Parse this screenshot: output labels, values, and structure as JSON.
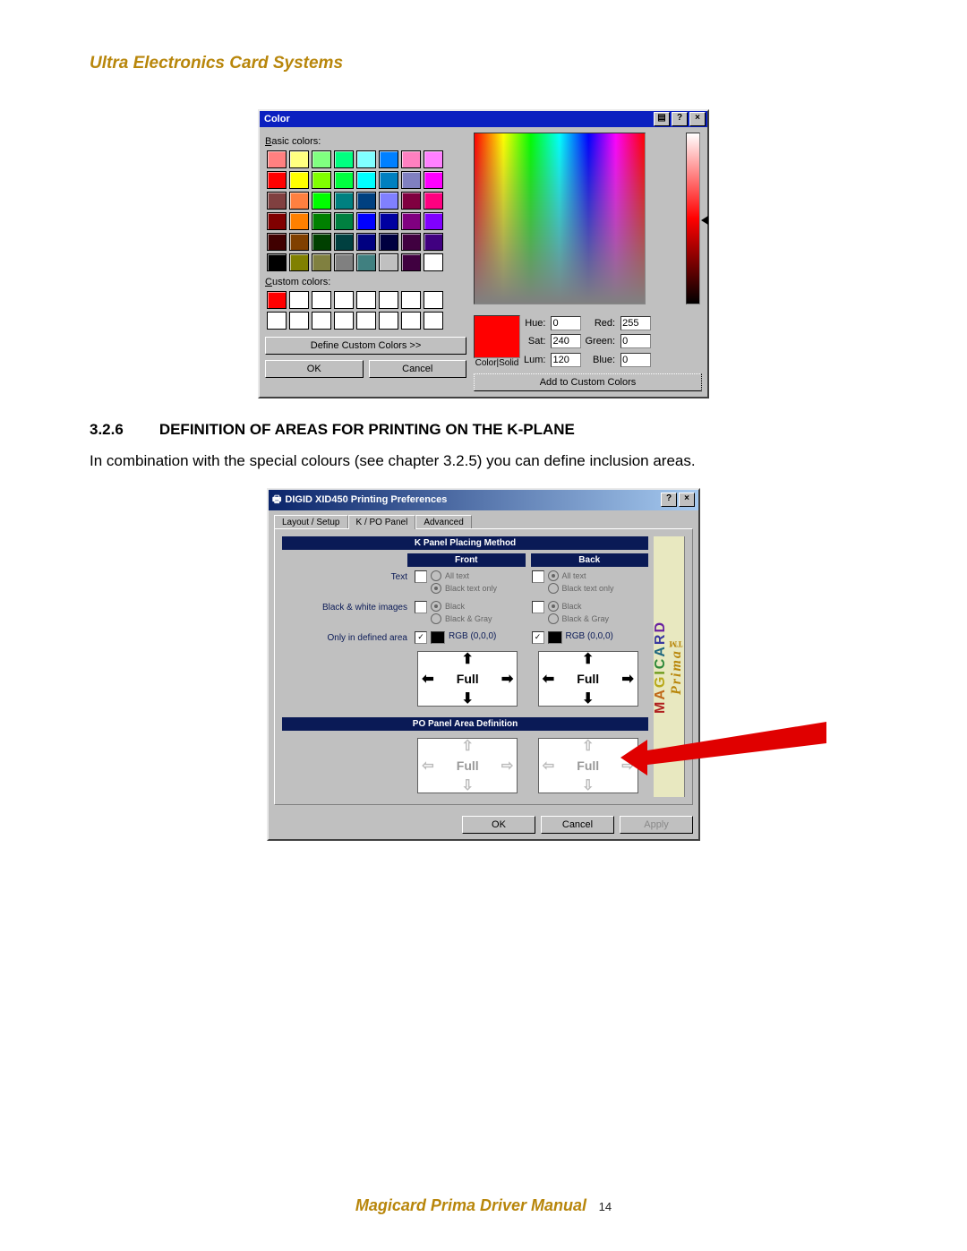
{
  "page": {
    "header_brand": "Ultra Electronics Card Systems",
    "footer_manual": "Magicard Prima Driver Manual",
    "footer_page": "14"
  },
  "color_dialog": {
    "title": "Color",
    "basic_label_pre": "B",
    "basic_label_post": "asic colors:",
    "custom_label_pre": "C",
    "custom_label_post": "ustom colors:",
    "define_btn": "Define Custom Colors >>",
    "ok": "OK",
    "cancel": "Cancel",
    "color_solid": "Color|Solid",
    "add_custom": "Add to Custom Colors",
    "fields": {
      "hue_label": "Hue:",
      "sat_label": "Sat:",
      "lum_label": "Lum:",
      "red_label": "Red:",
      "green_label": "Green:",
      "blue_label": "Blue:",
      "hue": "0",
      "sat": "240",
      "lum": "120",
      "red": "255",
      "green": "0",
      "blue": "0"
    },
    "basic_colors": [
      "#ff8080",
      "#ffff80",
      "#80ff80",
      "#00ff80",
      "#80ffff",
      "#0080ff",
      "#ff80c0",
      "#ff80ff",
      "#ff0000",
      "#ffff00",
      "#80ff00",
      "#00ff40",
      "#00ffff",
      "#0080c0",
      "#8080c0",
      "#ff00ff",
      "#804040",
      "#ff8040",
      "#00ff00",
      "#008080",
      "#004080",
      "#8080ff",
      "#800040",
      "#ff0080",
      "#800000",
      "#ff8000",
      "#008000",
      "#008040",
      "#0000ff",
      "#0000a0",
      "#800080",
      "#8000ff",
      "#400000",
      "#804000",
      "#004000",
      "#004040",
      "#000080",
      "#000040",
      "#400040",
      "#400080",
      "#000000",
      "#808000",
      "#808040",
      "#808080",
      "#408080",
      "#c0c0c0",
      "#400040",
      "#ffffff"
    ],
    "custom_colors": [
      "#ff0000",
      "#ffffff",
      "#ffffff",
      "#ffffff",
      "#ffffff",
      "#ffffff",
      "#ffffff",
      "#ffffff",
      "#ffffff",
      "#ffffff",
      "#ffffff",
      "#ffffff",
      "#ffffff",
      "#ffffff",
      "#ffffff",
      "#ffffff"
    ]
  },
  "section": {
    "num": "3.2.6",
    "title": "DEFINITION OF AREAS FOR PRINTING ON THE K-PLANE",
    "body": "In combination with the special colours (see chapter 3.2.5) you can define inclusion areas."
  },
  "pref_dialog": {
    "title": "DIGID XID450 Printing Preferences",
    "tabs": [
      "Layout / Setup",
      "K / PO Panel",
      "Advanced"
    ],
    "active_tab": 1,
    "band_kp": "K Panel Placing Method",
    "front": "Front",
    "back": "Back",
    "rows": {
      "text": {
        "label": "Text",
        "opts": [
          "All text",
          "Black text only"
        ],
        "front_checked": false,
        "front_sel": 1,
        "back_checked": false,
        "back_sel": 0
      },
      "bw": {
        "label": "Black & white images",
        "opts": [
          "Black",
          "Black & Gray"
        ],
        "front_checked": false,
        "front_sel": 0,
        "back_checked": false,
        "back_sel": 0
      },
      "area": {
        "label": "Only in defined area",
        "rgb_label": "RGB (0,0,0)",
        "front_checked": true,
        "back_checked": true
      }
    },
    "full_label": "Full",
    "band_po": "PO Panel Area Definition",
    "po_front_checked": false,
    "po_back_checked": false,
    "brand_magicard": "MAGICARD",
    "brand_prima": "Prima™",
    "buttons": {
      "ok": "OK",
      "cancel": "Cancel",
      "apply": "Apply"
    }
  }
}
